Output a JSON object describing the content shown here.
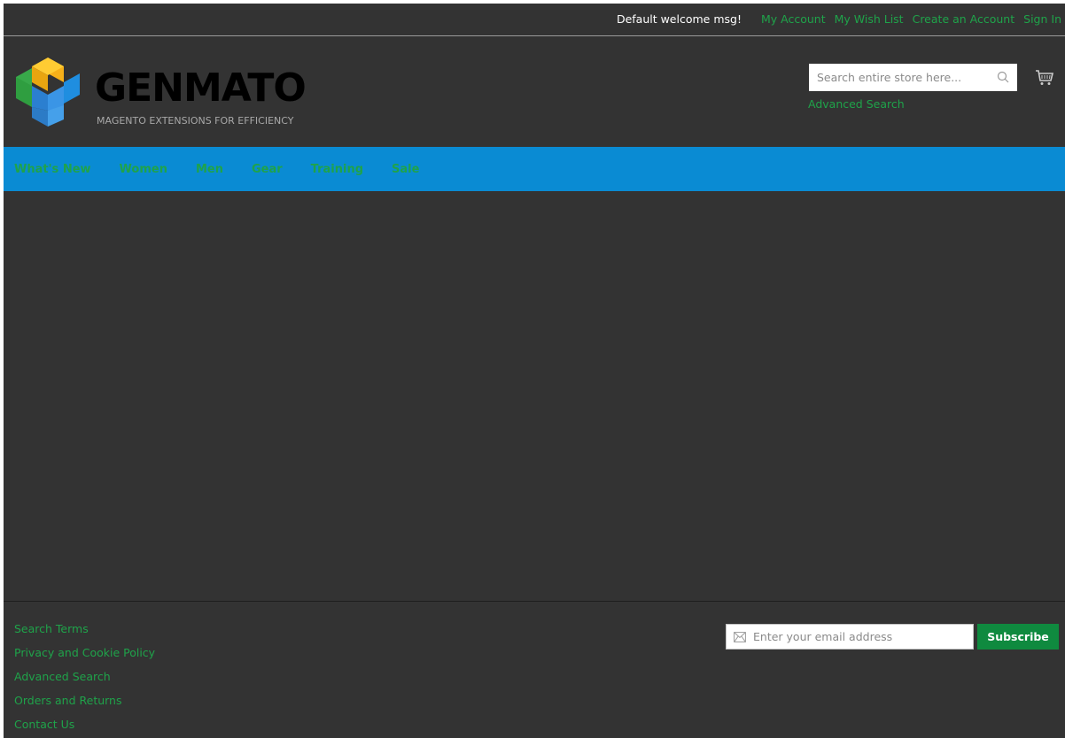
{
  "colors": {
    "background": "#333333",
    "link": "#1fa34a",
    "nav_bar": "#0a8bd3",
    "subscribe_button": "#0f8a3f"
  },
  "top_panel": {
    "welcome": "Default welcome msg!",
    "links": [
      "My Account",
      "My Wish List",
      "Create an Account",
      "Sign In"
    ]
  },
  "logo": {
    "word": "GENMATO",
    "tagline": "MAGENTO EXTENSIONS FOR EFFICIENCY"
  },
  "search": {
    "placeholder": "Search entire store here...",
    "advanced_link": "Advanced Search",
    "icon": "search-icon"
  },
  "cart": {
    "icon": "cart-icon"
  },
  "nav": {
    "items": [
      "What's New",
      "Women",
      "Men",
      "Gear",
      "Training",
      "Sale"
    ]
  },
  "footer": {
    "links": [
      "Search Terms",
      "Privacy and Cookie Policy",
      "Advanced Search",
      "Orders and Returns",
      "Contact Us"
    ],
    "newsletter": {
      "placeholder": "Enter your email address",
      "button": "Subscribe",
      "icon": "envelope-icon"
    }
  }
}
